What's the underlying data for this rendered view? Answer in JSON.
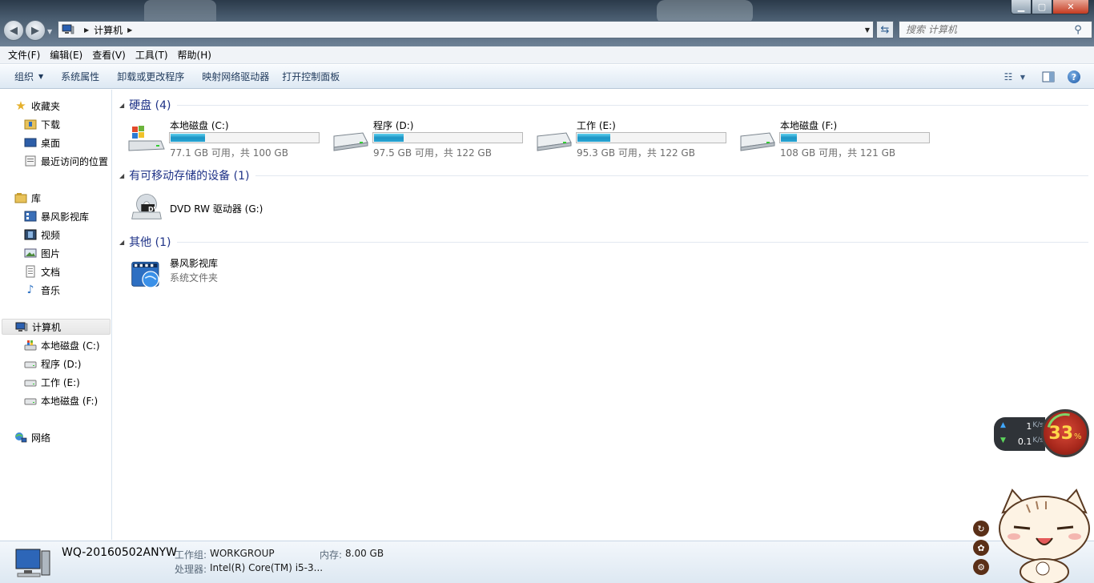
{
  "window": {
    "minimize_icon": "minimize-icon",
    "maximize_icon": "maximize-icon",
    "close_icon": "close-icon"
  },
  "address": {
    "crumb": "计算机",
    "search_placeholder": "搜索 计算机"
  },
  "menu": [
    "文件(F)",
    "编辑(E)",
    "查看(V)",
    "工具(T)",
    "帮助(H)"
  ],
  "commands": {
    "organize": "组织",
    "system_props": "系统属性",
    "uninstall": "卸载或更改程序",
    "map_drive": "映射网络驱动器",
    "control_panel": "打开控制面板"
  },
  "sidebar": {
    "favorites": "收藏夹",
    "downloads": "下载",
    "desktop": "桌面",
    "recent": "最近访问的位置",
    "library": "库",
    "baofeng": "暴风影视库",
    "video": "视频",
    "pictures": "图片",
    "documents": "文档",
    "music": "音乐",
    "computer": "计算机",
    "drive_c": "本地磁盘 (C:)",
    "drive_d": "程序 (D:)",
    "drive_e": "工作 (E:)",
    "drive_f": "本地磁盘 (F:)",
    "network": "网络"
  },
  "groups": {
    "hdd": "硬盘 (4)",
    "removable": "有可移动存储的设备 (1)",
    "other": "其他 (1)"
  },
  "drives": [
    {
      "name": "本地磁盘 (C:)",
      "free": "77.1 GB 可用，共 100 GB",
      "used_fraction": 0.23,
      "os": true
    },
    {
      "name": "程序 (D:)",
      "free": "97.5 GB 可用，共 122 GB",
      "used_fraction": 0.2
    },
    {
      "name": "工作 (E:)",
      "free": "95.3 GB 可用，共 122 GB",
      "used_fraction": 0.22
    },
    {
      "name": "本地磁盘 (F:)",
      "free": "108 GB 可用，共 121 GB",
      "used_fraction": 0.11
    }
  ],
  "dvd": {
    "name": "DVD RW 驱动器 (G:)",
    "badge": "DVD"
  },
  "other_item": {
    "name": "暴风影视库",
    "type": "系统文件夹"
  },
  "details": {
    "computer_name": "WQ-20160502ANYW",
    "workgroup_label": "工作组:",
    "workgroup": "WORKGROUP",
    "memory_label": "内存:",
    "memory": "8.00 GB",
    "cpu_label": "处理器:",
    "cpu": "Intel(R) Core(TM) i5-3..."
  },
  "widget": {
    "up_value": "1",
    "up_unit": "K/s",
    "down_value": "0.1",
    "down_unit": "K/s",
    "percent": "33",
    "percent_sign": "%"
  }
}
